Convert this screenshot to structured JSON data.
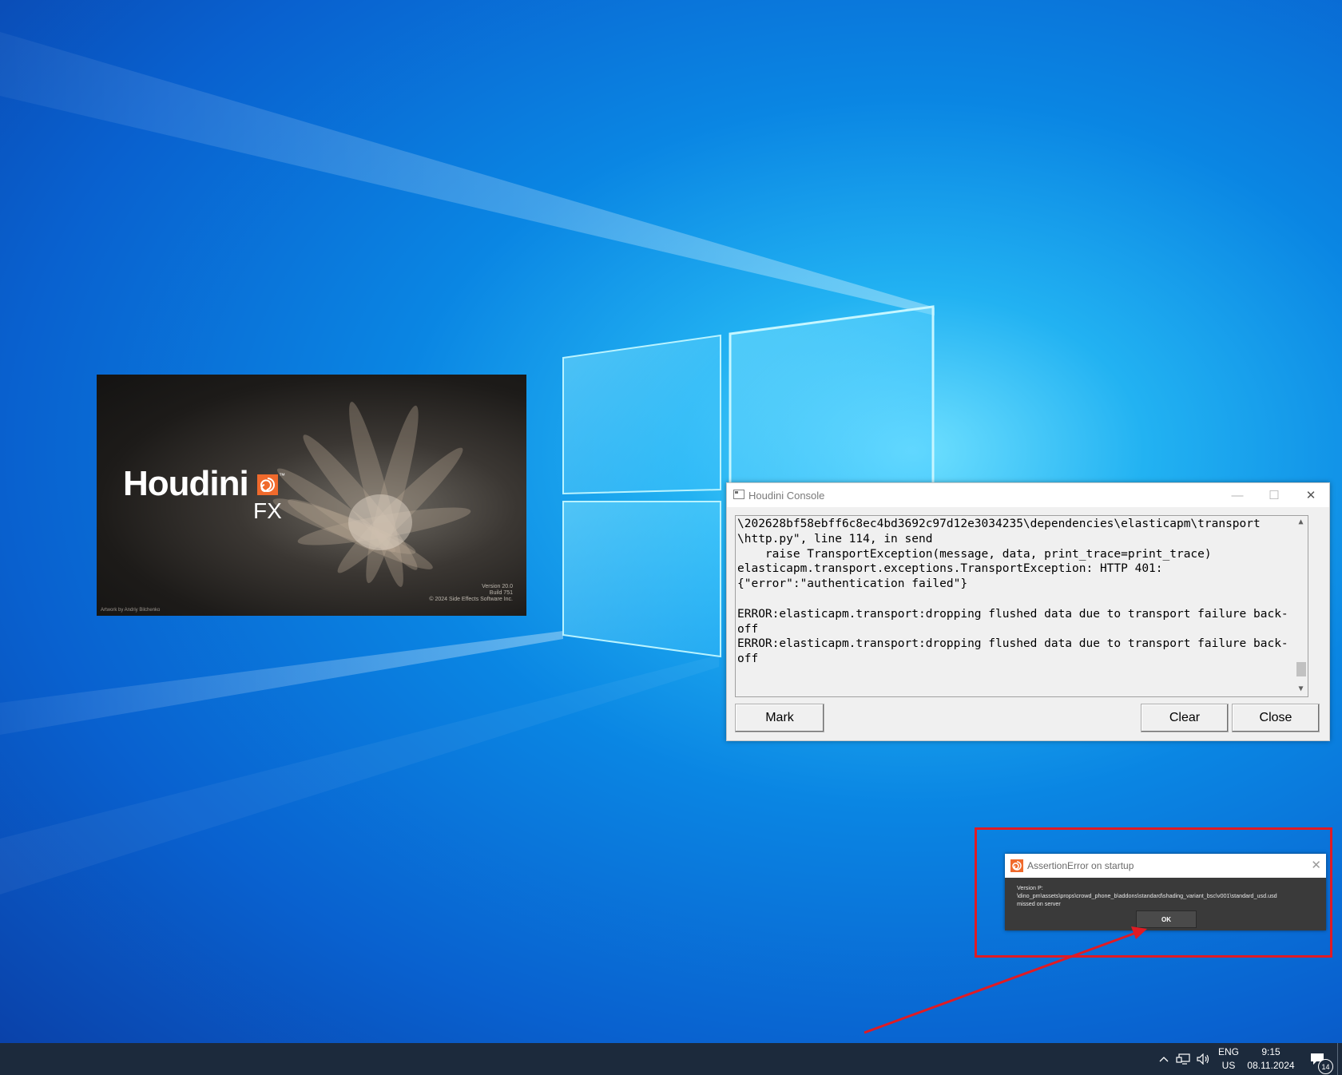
{
  "splash": {
    "product": "Houdini",
    "edition": "FX",
    "trademark": "™",
    "version": "Version 20.0",
    "build": "Build 751",
    "copyright": "© 2024 Side Effects Software Inc.",
    "artwork_credit": "Artwork by Andriy Bilchenko"
  },
  "console": {
    "title": "Houdini Console",
    "lines": [
      "\\202628bf58ebff6c8ec4bd3692c97d12e3034235\\dependencies\\elasticapm\\transport",
      "\\http.py\", line 114, in send",
      "    raise TransportException(message, data, print_trace=print_trace)",
      "elasticapm.transport.exceptions.TransportException: HTTP 401:",
      "{\"error\":\"authentication failed\"}",
      "",
      "ERROR:elasticapm.transport:dropping flushed data due to transport failure back-",
      "off",
      "ERROR:elasticapm.transport:dropping flushed data due to transport failure back-",
      "off"
    ],
    "buttons": {
      "mark": "Mark",
      "clear": "Clear",
      "close": "Close"
    }
  },
  "assertion_dialog": {
    "title": "AssertionError on startup",
    "message_lines": [
      "Version P:",
      "\\dino_pm\\assets\\props\\crowd_phone_b\\addons\\standard\\shading_variant_bsc\\v001\\standard_usd.usd",
      "missed on server"
    ],
    "ok": "OK"
  },
  "taskbar": {
    "lang_top": "ENG",
    "lang_bottom": "US",
    "time": "9:15",
    "date": "08.11.2024",
    "notifications": "14"
  },
  "colors": {
    "annotation_red": "#e01b24",
    "taskbar": "#1c2a3c",
    "houdini_orange": "#f06a2c"
  }
}
